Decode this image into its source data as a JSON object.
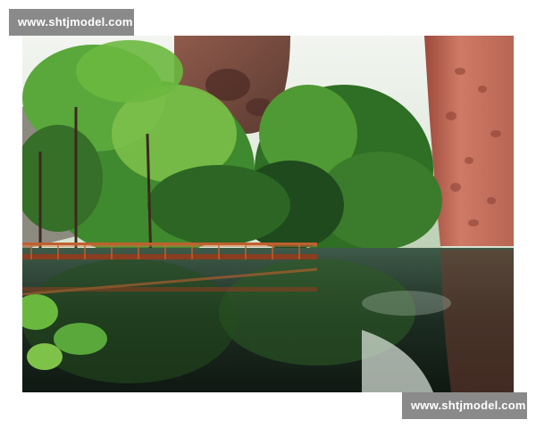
{
  "watermarks": {
    "top_left": "www.shtjmodel.com",
    "bottom_right": "www.shtjmodel.com"
  },
  "colors": {
    "foliage_dark": "#1f4a1d",
    "foliage_mid": "#3f8a2e",
    "foliage_light": "#7fc24a",
    "cliff_red": "#c8705e",
    "cliff_shadow": "#7a3c32",
    "walkway_rail": "#b4532a",
    "water_dark": "#132018",
    "sky": "#e9efe6",
    "watermark_bg": "#8a8a8a"
  }
}
